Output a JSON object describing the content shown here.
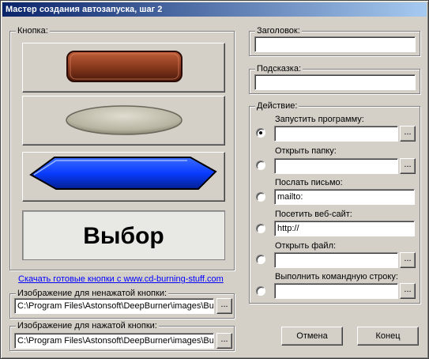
{
  "window": {
    "title": "Мастер создания автозапуска, шаг 2"
  },
  "button_group": {
    "legend": "Кнопка:",
    "previews": [
      {
        "style": "brown-rounded-rect"
      },
      {
        "style": "gray-stone-ellipse"
      },
      {
        "style": "blue-hexagon"
      },
      {
        "style": "text",
        "text": "Выбор"
      }
    ],
    "download_link": "Скачать готовые кнопки с www.cd-burning-stuff.com"
  },
  "normal_image": {
    "legend": "Изображение для ненажатой кнопки:",
    "value": "C:\\Program Files\\Astonsoft\\DeepBurner\\images\\But",
    "browse_label": "..."
  },
  "pressed_image": {
    "legend": "Изображение для нажатой кнопки:",
    "value": "C:\\Program Files\\Astonsoft\\DeepBurner\\images\\But",
    "browse_label": "..."
  },
  "title_field": {
    "legend": "Заголовок:",
    "value": ""
  },
  "hint_field": {
    "legend": "Подсказка:",
    "value": ""
  },
  "action": {
    "legend": "Действие:",
    "options": [
      {
        "label": "Запустить программу:",
        "value": "",
        "selected": true,
        "browse": "..."
      },
      {
        "label": "Открыть папку:",
        "value": "",
        "selected": false,
        "browse": "..."
      },
      {
        "label": "Послать письмо:",
        "value": "mailto:",
        "selected": false
      },
      {
        "label": "Посетить веб-сайт:",
        "value": "http://",
        "selected": false
      },
      {
        "label": "Открыть файл:",
        "value": "",
        "selected": false,
        "browse": "..."
      },
      {
        "label": "Выполнить командную строку:",
        "value": "",
        "selected": false,
        "browse": "..."
      }
    ]
  },
  "footer": {
    "cancel_label": "Отмена",
    "finish_label": "Конец"
  },
  "colors": {
    "title_start": "#0a246a",
    "title_end": "#a6caf0",
    "face": "#d4d0c8",
    "link": "#0000ff",
    "brown_button": "#8b3a1e",
    "stone_button": "#bcb9a8",
    "blue_button": "#0a3cff"
  }
}
